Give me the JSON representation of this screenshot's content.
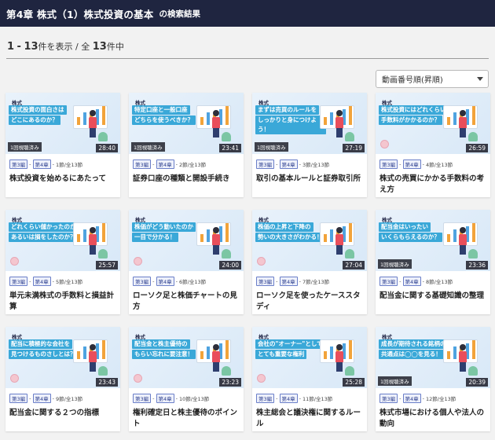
{
  "header": {
    "title": "第4章 株式（1）株式投資の基本",
    "suffix": "の検索結果"
  },
  "summary": {
    "range_start": "1",
    "range_dash": "-",
    "range_end": "13",
    "shown_label": "件を表示 / 全",
    "total": "13",
    "total_suffix": "件中"
  },
  "sort": {
    "selected": "動画番号順(昇順)"
  },
  "colors": {
    "header_bg": "#1f2540",
    "banner": "#3aa8d8",
    "tag_border": "#6a7ec8"
  },
  "cards": [
    {
      "stock": "株式",
      "banner": [
        "株式投資の面白さは",
        "どこにあるのか？"
      ],
      "watched": "1回視聴済み",
      "duration": "28:40",
      "tag1": "第3編",
      "tag2": "第4章",
      "section": "1節/全13節",
      "title": "株式投資を始めるにあたって"
    },
    {
      "stock": "株式",
      "banner": [
        "特定口座と一般口座",
        "どちらを使うべきか？"
      ],
      "watched": "1回視聴済み",
      "duration": "23:41",
      "tag1": "第3編",
      "tag2": "第4章",
      "section": "2節/全13節",
      "title": "証券口座の種類と開設手続き"
    },
    {
      "stock": "株式",
      "banner": [
        "まずは売買のルールを",
        "しっかりと身につけよう！"
      ],
      "watched": "1回視聴済み",
      "duration": "27:19",
      "tag1": "第3編",
      "tag2": "第4章",
      "section": "3節/全13節",
      "title": "取引の基本ルールと証券取引所"
    },
    {
      "stock": "株式",
      "banner": [
        "株式投資にはどれくらい",
        "手数料がかかるのか？"
      ],
      "watched": "",
      "duration": "26:59",
      "tag1": "第3編",
      "tag2": "第4章",
      "section": "4節/全13節",
      "title": "株式の売買にかかる手数料の考え方"
    },
    {
      "stock": "株式",
      "banner": [
        "どれくらい儲かったのか",
        "あるいは損をしたのか？"
      ],
      "watched": "",
      "duration": "25:57",
      "tag1": "第3編",
      "tag2": "第4章",
      "section": "5節/全13節",
      "title": "単元未満株式の手数料と損益計算"
    },
    {
      "stock": "株式",
      "banner": [
        "株価がどう動いたのか",
        "一目で分かる！"
      ],
      "watched": "",
      "duration": "24:00",
      "tag1": "第3編",
      "tag2": "第4章",
      "section": "6節/全13節",
      "title": "ローソク足と株価チャートの見方"
    },
    {
      "stock": "株式",
      "banner": [
        "株価の上昇と下降の",
        "勢いの大きさがわかる！"
      ],
      "watched": "",
      "duration": "27:04",
      "tag1": "第3編",
      "tag2": "第4章",
      "section": "7節/全13節",
      "title": "ローソク足を使ったケーススタディ"
    },
    {
      "stock": "株式",
      "banner": [
        "配当金はいったい",
        "いくらもらえるのか？"
      ],
      "watched": "1回視聴済み",
      "duration": "23:36",
      "tag1": "第3編",
      "tag2": "第4章",
      "section": "8節/全13節",
      "title": "配当金に関する基礎知識の整理"
    },
    {
      "stock": "株式",
      "banner": [
        "配当に積極的な会社を",
        "見つけるものさしとは？"
      ],
      "watched": "",
      "duration": "23:43",
      "tag1": "第3編",
      "tag2": "第4章",
      "section": "9節/全13節",
      "title": "配当金に関する２つの指標"
    },
    {
      "stock": "株式",
      "banner": [
        "配当金と株主優待の",
        "もらい忘れに要注意！"
      ],
      "watched": "",
      "duration": "23:23",
      "tag1": "第3編",
      "tag2": "第4章",
      "section": "10節/全13節",
      "title": "権利確定日と株主優待のポイント"
    },
    {
      "stock": "株式",
      "banner": [
        "会社の\"オーナー\"として",
        "とても重要な権利"
      ],
      "watched": "",
      "duration": "25:28",
      "tag1": "第3編",
      "tag2": "第4章",
      "section": "11節/全13節",
      "title": "株主総会と議決権に関するルール"
    },
    {
      "stock": "株式",
      "banner": [
        "成長が期待される銘柄の",
        "共通点は◯◯を見る！"
      ],
      "watched": "1回視聴済み",
      "duration": "20:39",
      "tag1": "第3編",
      "tag2": "第4章",
      "section": "12節/全13節",
      "title": "株式市場における個人や法人の動向"
    }
  ]
}
